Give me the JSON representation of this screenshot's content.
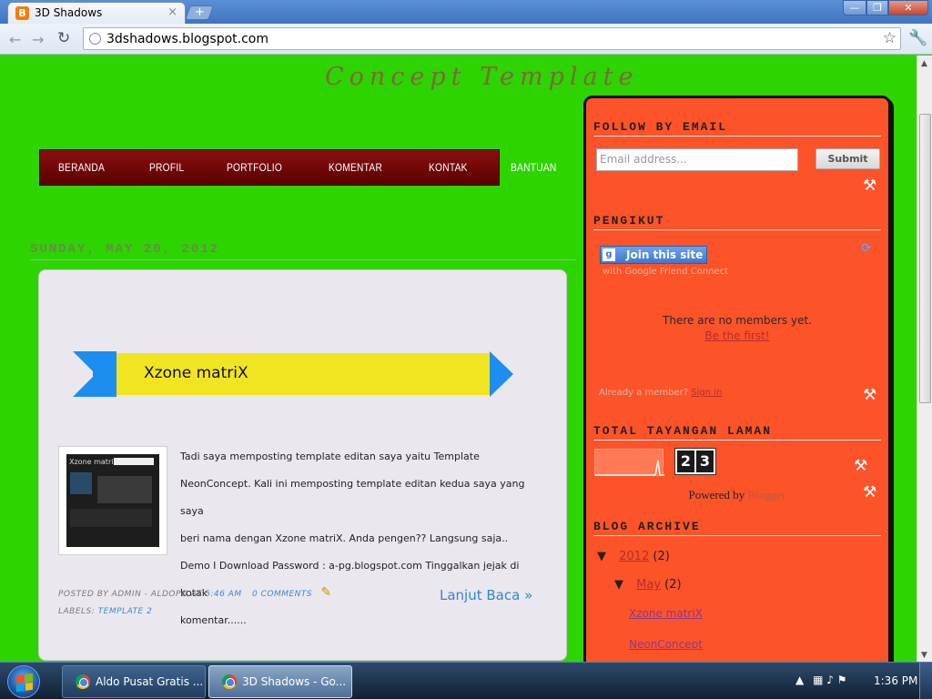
{
  "browser": {
    "tab_title": "3D Shadows",
    "tab_favicon_letter": "B",
    "tab_close": "×",
    "new_tab": "+",
    "url": "3dshadows.blogspot.com",
    "window_controls": {
      "minimize": "—",
      "maximize": "❐",
      "close": "✕"
    },
    "nav_icons": {
      "back": "back-arrow-icon",
      "forward": "forward-arrow-icon",
      "reload": "reload-icon",
      "star": "star-icon",
      "wrench": "wrench-icon"
    }
  },
  "blog": {
    "title": "Concept Template",
    "nav": [
      "BERANDA",
      "PROFIL",
      "PORTFOLIO",
      "KOMENTAR",
      "KONTAK",
      "BANTUAN"
    ],
    "date_header": "SUNDAY, MAY 20, 2012"
  },
  "post": {
    "banner_text": "Xzone matriX",
    "thumb_title": "Xzone matriX",
    "body_lines": [
      "Tadi saya memposting template editan saya yaitu Template",
      "NeonConcept. Kali ini memposting template editan kedua saya yang saya",
      "beri nama dengan Xzone matriX. Anda pengen?? Langsung saja..",
      "Demo I Download Password : a-pg.blogspot.com Tinggalkan jejak di kotak",
      "komentar......"
    ],
    "footer_prefix": "POSTED BY ADMIN - ALDOPG AT",
    "footer_time": "5:46 AM",
    "footer_comments": "0 COMMENTS",
    "labels_prefix": "LABELS:",
    "label": "TEMPLATE 2",
    "read_more": "Lanjut Baca »"
  },
  "sidebar": {
    "follow_title": "FOLLOW BY EMAIL",
    "email_placeholder": "Email address...",
    "submit": "Submit",
    "followers_title": "PENGIKUT",
    "join_button": "Join this site",
    "gfc_sub": "with Google Friend Connect",
    "no_members": "There are no members yet.",
    "be_first": "Be the first!",
    "already_member": "Already a member?",
    "sign_in": "Sign in",
    "pageviews_title": "TOTAL TAYANGAN LAMAN",
    "pageview_digits": [
      "2",
      "3"
    ],
    "powered_by": "Powered by",
    "blogger": "Blogger",
    "archive_title": "BLOG ARCHIVE",
    "archive": {
      "year": "2012",
      "year_count": "(2)",
      "month": "May",
      "month_count": "(2)",
      "posts": [
        "Xzone matriX",
        "NeonConcept"
      ]
    }
  },
  "taskbar": {
    "tasks": [
      "Aldo Pusat Gratis ...",
      "3D Shadows - Go..."
    ],
    "clock": "1:36 PM"
  },
  "colors": {
    "page_background": "#2ed400",
    "sidebar_background": "#fd5329",
    "navbar_background": "#7a0a0a",
    "post_background": "#ebe7ef",
    "banner_yellow": "#f1e421",
    "banner_blue": "#1d8ef0"
  }
}
